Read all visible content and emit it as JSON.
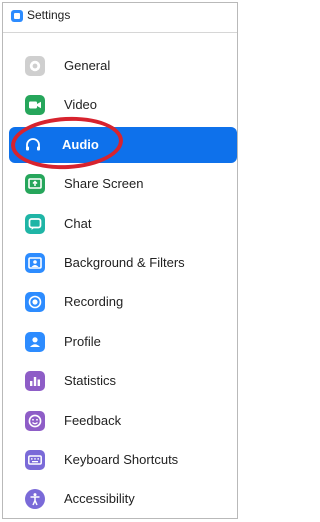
{
  "window": {
    "title": "Settings"
  },
  "sidebar": {
    "items": [
      {
        "label": "General",
        "icon": "gear-icon",
        "color": "#c9c9c9"
      },
      {
        "label": "Video",
        "icon": "video-camera-icon",
        "color": "#26a65b"
      },
      {
        "label": "Audio",
        "icon": "headphones-icon",
        "color": "#ffffff",
        "selected": true
      },
      {
        "label": "Share Screen",
        "icon": "share-screen-icon",
        "color": "#26a65b"
      },
      {
        "label": "Chat",
        "icon": "chat-bubble-icon",
        "color": "#1fb5a6"
      },
      {
        "label": "Background & Filters",
        "icon": "background-icon",
        "color": "#2d8cff"
      },
      {
        "label": "Recording",
        "icon": "record-icon",
        "color": "#2d8cff"
      },
      {
        "label": "Profile",
        "icon": "profile-icon",
        "color": "#2d8cff"
      },
      {
        "label": "Statistics",
        "icon": "bar-chart-icon",
        "color": "#8e5dc7"
      },
      {
        "label": "Feedback",
        "icon": "smiley-icon",
        "color": "#8e5dc7"
      },
      {
        "label": "Keyboard Shortcuts",
        "icon": "keyboard-icon",
        "color": "#7a6ad8"
      },
      {
        "label": "Accessibility",
        "icon": "accessibility-icon",
        "color": "#7a6ad8"
      }
    ]
  },
  "annotation": {
    "color": "#d7232e"
  },
  "accent": "#0e71eb"
}
